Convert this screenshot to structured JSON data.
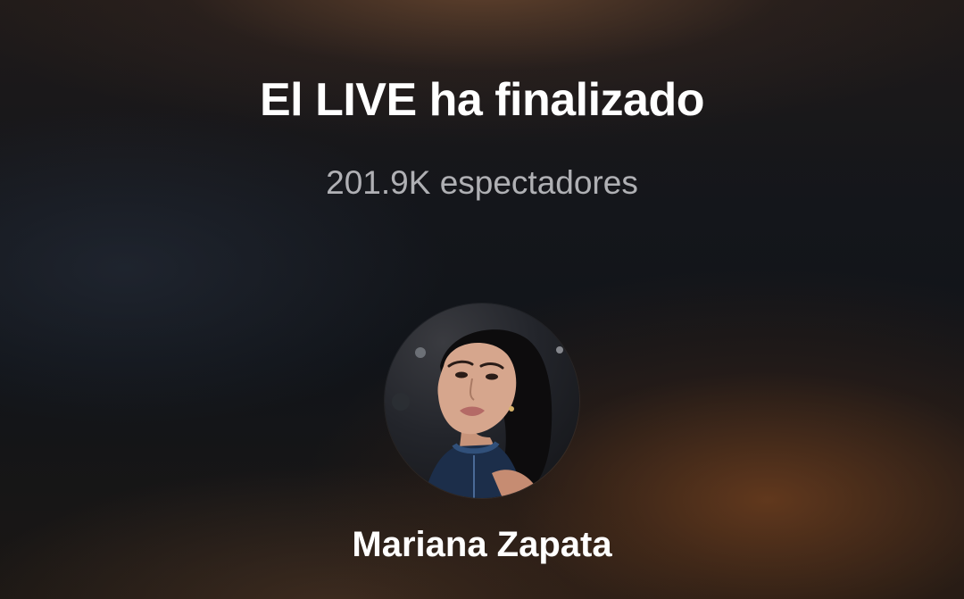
{
  "live_ended": {
    "title": "El LIVE ha finalizado",
    "viewers": "201.9K espectadores"
  },
  "host": {
    "name": "Mariana Zapata",
    "avatar_icon": "profile-photo-avatar"
  },
  "colors": {
    "background_top": "#1f1a19",
    "background_middle": "#111419",
    "background_warm_glow": "#6e3e1e",
    "title": "#ffffff",
    "subtitle": "#b8b8bd"
  }
}
